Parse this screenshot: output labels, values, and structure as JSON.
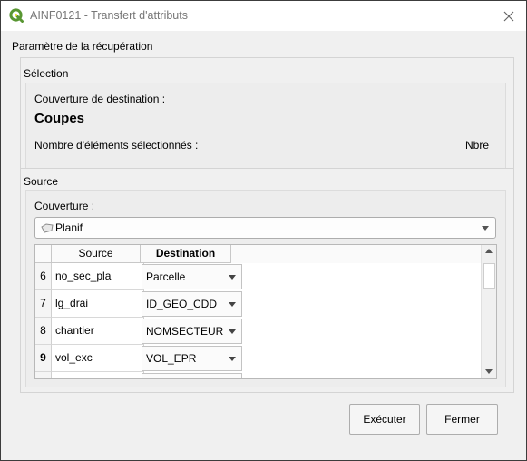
{
  "window": {
    "title": "AINF0121 - Transfert d'attributs"
  },
  "params": {
    "label": "Paramètre de la récupération"
  },
  "selection": {
    "label": "Sélection",
    "couverture_label": "Couverture de destination :",
    "couverture_value": "Coupes",
    "count_label": "Nombre d'éléments sélectionnés :",
    "count_value": "Nbre"
  },
  "source": {
    "label": "Source",
    "couverture_label": "Couverture :",
    "combo_value": "Planif",
    "combo_icon": "polygon-layer-icon"
  },
  "table": {
    "headers": {
      "source": "Source",
      "destination": "Destination"
    },
    "rows": [
      {
        "num": "6",
        "source": "no_sec_pla",
        "destination": "Parcelle"
      },
      {
        "num": "7",
        "source": "lg_drai",
        "destination": "ID_GEO_CDD"
      },
      {
        "num": "8",
        "source": "chantier",
        "destination": "NOMSECTEUR"
      },
      {
        "num": "9",
        "source": "vol_exc",
        "destination": "VOL_EPR"
      }
    ]
  },
  "buttons": {
    "execute": "Exécuter",
    "close": "Fermer"
  },
  "colors": {
    "qgis_green": "#589632",
    "qgis_yellow": "#f0e130"
  }
}
